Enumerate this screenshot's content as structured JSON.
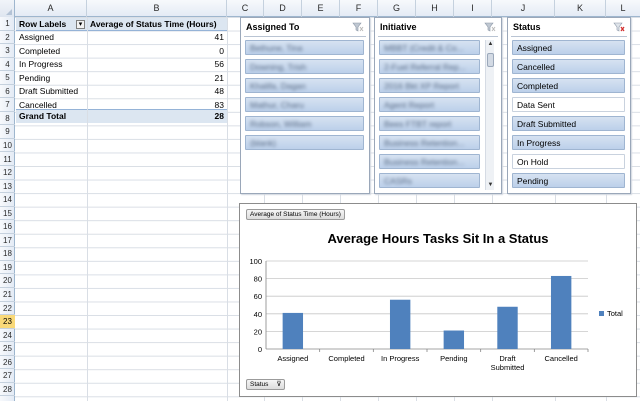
{
  "sheet": {
    "columns": [
      "A",
      "B",
      "C",
      "D",
      "E",
      "F",
      "G",
      "H",
      "I",
      "J",
      "K",
      "L"
    ],
    "rows": [
      "1",
      "2",
      "3",
      "4",
      "5",
      "6",
      "7",
      "8",
      "9",
      "10",
      "11",
      "12",
      "13",
      "14",
      "15",
      "16",
      "17",
      "18",
      "19",
      "20",
      "21",
      "22",
      "23",
      "24",
      "25",
      "26",
      "27",
      "28"
    ],
    "active_row": "23"
  },
  "pivot": {
    "row_labels_header": "Row Labels",
    "value_header": "Average of Status Time (Hours)",
    "rows": [
      {
        "label": "Assigned",
        "value": "41"
      },
      {
        "label": "Completed",
        "value": "0"
      },
      {
        "label": "In Progress",
        "value": "56"
      },
      {
        "label": "Pending",
        "value": "21"
      },
      {
        "label": "Draft Submitted",
        "value": "48"
      },
      {
        "label": "Cancelled",
        "value": "83"
      }
    ],
    "grand_total_label": "Grand Total",
    "grand_total_value": "28"
  },
  "slicers": {
    "assigned_to": {
      "title": "Assigned To",
      "items": [
        "Bethune, Tina",
        "Downing, Trish",
        "Khalifa, Dagan",
        "Mathur, Charu",
        "Robson, William",
        "(blank)"
      ]
    },
    "initiative": {
      "title": "Initiative",
      "items": [
        "MBBT (Credit & Co...",
        "2-Fuel Referral Rep...",
        "2016 Bkt XP Report",
        "Agent Report",
        "Bees FTBT report",
        "Business Retention...",
        "Business Retention...",
        "CASRs"
      ]
    },
    "status": {
      "title": "Status",
      "items": [
        {
          "label": "Assigned",
          "selected": true
        },
        {
          "label": "Cancelled",
          "selected": true
        },
        {
          "label": "Completed",
          "selected": true
        },
        {
          "label": "Data Sent",
          "selected": false
        },
        {
          "label": "Draft Submitted",
          "selected": true
        },
        {
          "label": "In Progress",
          "selected": true
        },
        {
          "label": "On Hold",
          "selected": false
        },
        {
          "label": "Pending",
          "selected": true
        }
      ]
    }
  },
  "chart_tags": {
    "value_field": "Average of Status Time (Hours)",
    "axis_field": "Status"
  },
  "colors": {
    "bar": "#4f81bd",
    "selected_slicer": "#bcd0ea",
    "pivot_header": "#dce6f1",
    "active_row": "#f9d979"
  },
  "chart_data": {
    "type": "bar",
    "title": "Average Hours Tasks Sit In a Status",
    "categories": [
      "Assigned",
      "Completed",
      "In Progress",
      "Pending",
      "Draft Submitted",
      "Cancelled"
    ],
    "series": [
      {
        "name": "Total",
        "values": [
          41,
          0,
          56,
          21,
          48,
          83
        ]
      }
    ],
    "ylim": [
      0,
      100
    ],
    "yticks": [
      0,
      20,
      40,
      60,
      80,
      100
    ],
    "xlabel": "",
    "ylabel": "",
    "grid": true,
    "legend": "right"
  }
}
